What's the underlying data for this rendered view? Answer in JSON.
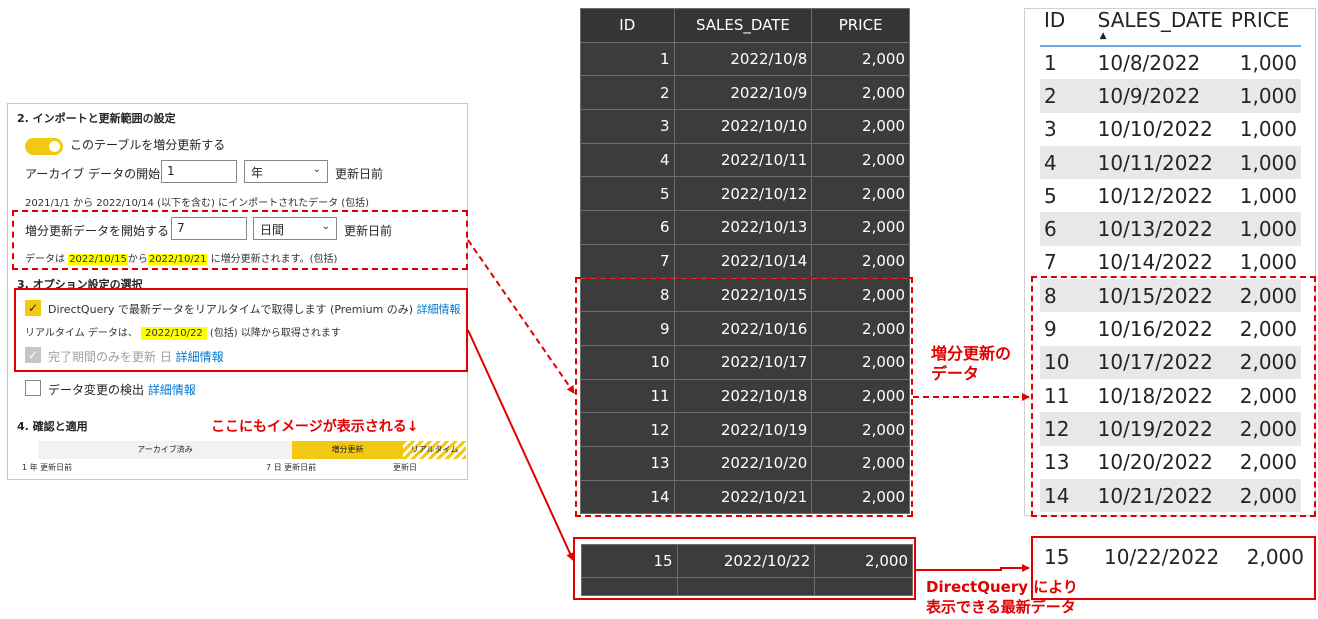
{
  "settings": {
    "section2_title": "2. インポートと更新範囲の設定",
    "toggle_label": "このテーブルを増分更新する",
    "archive_label": "アーカイブ データの開始",
    "archive_value": "1",
    "archive_unit": "年",
    "archive_suffix": "更新日前",
    "archive_info": "2021/1/1 から 2022/10/14 (以下を含む) にインポートされたデータ (包括)",
    "incremental_label": "増分更新データを開始する",
    "incremental_value": "7",
    "incremental_unit": "日間",
    "incremental_suffix": "更新日前",
    "incr_info_prefix": "データは",
    "incr_info_from": "2022/10/15",
    "incr_info_mid": "から",
    "incr_info_to": "2022/10/21",
    "incr_info_suffix": "に増分更新されます。(包括)",
    "section3_title": "3. オプション設定の選択",
    "directquery_label": "DirectQuery で最新データをリアルタイムで取得します (Premium のみ)",
    "directquery_link": "詳細情報",
    "realtime_prefix": "リアルタイム データは、",
    "realtime_date": "2022/10/22",
    "realtime_suffix": "(包括) 以降から取得されます",
    "complete_label": "完了期間のみを更新 日",
    "complete_link": "詳細情報",
    "detect_label": "データ変更の検出",
    "detect_link": "詳細情報",
    "section4_title": "4. 確認と適用",
    "timeline": {
      "archived": "アーカイブ済み",
      "incremental": "増分更新",
      "realtime": "リアルタイム",
      "label_left": "1 年 更新日前",
      "label_mid": "7 日 更新日前",
      "label_right": "更新日"
    }
  },
  "annotations": {
    "image_note": "ここにもイメージが表示される↓",
    "incremental_line1": "増分更新の",
    "incremental_line2": "データ",
    "dq_line1": "DirectQuery により",
    "dq_line2": "表示できる最新データ"
  },
  "dark_table": {
    "headers": [
      "ID",
      "SALES_DATE",
      "PRICE"
    ],
    "rows": [
      [
        "1",
        "2022/10/8",
        "2,000"
      ],
      [
        "2",
        "2022/10/9",
        "2,000"
      ],
      [
        "3",
        "2022/10/10",
        "2,000"
      ],
      [
        "4",
        "2022/10/11",
        "2,000"
      ],
      [
        "5",
        "2022/10/12",
        "2,000"
      ],
      [
        "6",
        "2022/10/13",
        "2,000"
      ],
      [
        "7",
        "2022/10/14",
        "2,000"
      ],
      [
        "8",
        "2022/10/15",
        "2,000"
      ],
      [
        "9",
        "2022/10/16",
        "2,000"
      ],
      [
        "10",
        "2022/10/17",
        "2,000"
      ],
      [
        "11",
        "2022/10/18",
        "2,000"
      ],
      [
        "12",
        "2022/10/19",
        "2,000"
      ],
      [
        "13",
        "2022/10/20",
        "2,000"
      ],
      [
        "14",
        "2022/10/21",
        "2,000"
      ]
    ],
    "extra_row": [
      "15",
      "2022/10/22",
      "2,000"
    ]
  },
  "light_table": {
    "headers": [
      "ID",
      "SALES_DATE",
      "PRICE"
    ],
    "rows": [
      [
        "1",
        "10/8/2022",
        "1,000"
      ],
      [
        "2",
        "10/9/2022",
        "1,000"
      ],
      [
        "3",
        "10/10/2022",
        "1,000"
      ],
      [
        "4",
        "10/11/2022",
        "1,000"
      ],
      [
        "5",
        "10/12/2022",
        "1,000"
      ],
      [
        "6",
        "10/13/2022",
        "1,000"
      ],
      [
        "7",
        "10/14/2022",
        "1,000"
      ],
      [
        "8",
        "10/15/2022",
        "2,000"
      ],
      [
        "9",
        "10/16/2022",
        "2,000"
      ],
      [
        "10",
        "10/17/2022",
        "2,000"
      ],
      [
        "11",
        "10/18/2022",
        "2,000"
      ],
      [
        "12",
        "10/19/2022",
        "2,000"
      ],
      [
        "13",
        "10/20/2022",
        "2,000"
      ],
      [
        "14",
        "10/21/2022",
        "2,000"
      ]
    ],
    "extra_row": [
      "15",
      "10/22/2022",
      "2,000"
    ]
  }
}
